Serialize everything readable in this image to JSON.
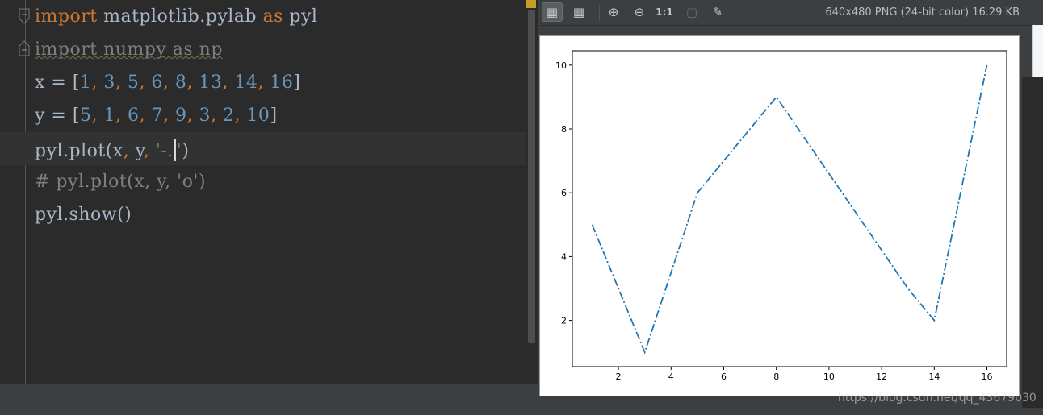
{
  "editor": {
    "lines": [
      {
        "tokens": [
          {
            "t": "import",
            "c": "#cc7832"
          },
          {
            "t": " matplotlib.pylab ",
            "c": "#a9b7c6"
          },
          {
            "t": "as",
            "c": "#cc7832"
          },
          {
            "t": " pyl",
            "c": "#a9b7c6"
          }
        ]
      },
      {
        "tokens": [
          {
            "t": "import numpy as np",
            "c": "#7f7f7f",
            "unused": true
          }
        ]
      },
      {
        "tokens": [
          {
            "t": "x = [",
            "c": "#a9b7c6"
          },
          {
            "t": "1",
            "c": "#6897bb"
          },
          {
            "t": ", ",
            "c": "#cc7832"
          },
          {
            "t": "3",
            "c": "#6897bb"
          },
          {
            "t": ", ",
            "c": "#cc7832"
          },
          {
            "t": "5",
            "c": "#6897bb"
          },
          {
            "t": ", ",
            "c": "#cc7832"
          },
          {
            "t": "6",
            "c": "#6897bb"
          },
          {
            "t": ", ",
            "c": "#cc7832"
          },
          {
            "t": "8",
            "c": "#6897bb"
          },
          {
            "t": ", ",
            "c": "#cc7832"
          },
          {
            "t": "13",
            "c": "#6897bb"
          },
          {
            "t": ", ",
            "c": "#cc7832"
          },
          {
            "t": "14",
            "c": "#6897bb"
          },
          {
            "t": ", ",
            "c": "#cc7832"
          },
          {
            "t": "16",
            "c": "#6897bb"
          },
          {
            "t": "]",
            "c": "#a9b7c6"
          }
        ]
      },
      {
        "tokens": [
          {
            "t": "y = [",
            "c": "#a9b7c6"
          },
          {
            "t": "5",
            "c": "#6897bb"
          },
          {
            "t": ", ",
            "c": "#cc7832"
          },
          {
            "t": "1",
            "c": "#6897bb"
          },
          {
            "t": ", ",
            "c": "#cc7832"
          },
          {
            "t": "6",
            "c": "#6897bb"
          },
          {
            "t": ", ",
            "c": "#cc7832"
          },
          {
            "t": "7",
            "c": "#6897bb"
          },
          {
            "t": ", ",
            "c": "#cc7832"
          },
          {
            "t": "9",
            "c": "#6897bb"
          },
          {
            "t": ", ",
            "c": "#cc7832"
          },
          {
            "t": "3",
            "c": "#6897bb"
          },
          {
            "t": ", ",
            "c": "#cc7832"
          },
          {
            "t": "2",
            "c": "#6897bb"
          },
          {
            "t": ", ",
            "c": "#cc7832"
          },
          {
            "t": "10",
            "c": "#6897bb"
          },
          {
            "t": "]",
            "c": "#a9b7c6"
          }
        ]
      },
      {
        "current": true,
        "tokens": [
          {
            "t": "pyl.plot(x",
            "c": "#a9b7c6"
          },
          {
            "t": ", ",
            "c": "#cc7832"
          },
          {
            "t": "y",
            "c": "#a9b7c6"
          },
          {
            "t": ", ",
            "c": "#cc7832"
          },
          {
            "t": "'-.",
            "c": "#6a8759"
          },
          {
            "caret": true
          },
          {
            "t": "'",
            "c": "#6a8759"
          },
          {
            "t": ")",
            "c": "#a9b7c6"
          }
        ]
      },
      {
        "tokens": [
          {
            "t": "# pyl.plot(x, y, 'o')",
            "c": "#808080"
          }
        ]
      },
      {
        "tokens": [
          {
            "t": "pyl.show()",
            "c": "#a9b7c6"
          }
        ]
      }
    ]
  },
  "viewer": {
    "toolbar": {
      "buttons": [
        {
          "name": "checkerboard-background-icon",
          "glyph": "▦",
          "active": true
        },
        {
          "name": "grid-icon",
          "glyph": "▦",
          "active": false
        },
        {
          "name": "zoom-in-icon",
          "glyph": "⊕",
          "active": false
        },
        {
          "name": "zoom-out-icon",
          "glyph": "⊖",
          "active": false
        },
        {
          "name": "actual-size-button",
          "glyph": "1:1",
          "active": false
        },
        {
          "name": "fit-zoom-icon",
          "glyph": "▢",
          "active": false,
          "disabled": true
        },
        {
          "name": "color-picker-icon",
          "glyph": "✎",
          "active": false
        }
      ],
      "file_info": "640x480 PNG (24-bit color) 16.29 KB"
    }
  },
  "watermark": "https://blog.csdn.net/qq_43679030",
  "chart_data": {
    "type": "line",
    "x": [
      1,
      3,
      5,
      6,
      8,
      13,
      14,
      16
    ],
    "series": [
      {
        "values": [
          5,
          1,
          6,
          7,
          9,
          3,
          2,
          10
        ],
        "color": "#1f77b4",
        "linestyle": "-."
      }
    ],
    "xticks": [
      2,
      4,
      6,
      8,
      10,
      12,
      14,
      16
    ],
    "yticks": [
      2,
      4,
      6,
      8,
      10
    ],
    "xlim": [
      0.25,
      16.75
    ],
    "ylim": [
      0.55,
      10.45
    ],
    "grid": false
  }
}
